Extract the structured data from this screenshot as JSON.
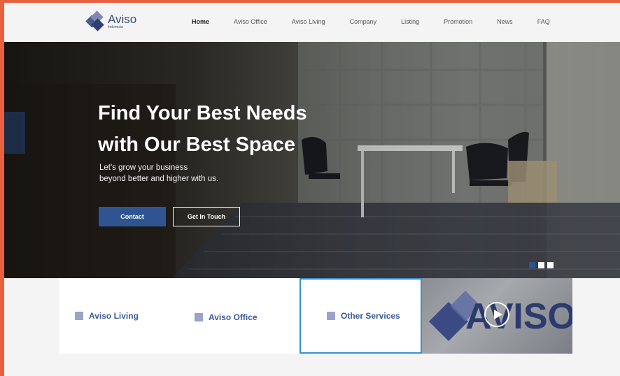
{
  "brand": {
    "name": "Aviso",
    "subtitle": "Indonesia"
  },
  "nav": {
    "items": [
      {
        "label": "Home",
        "active": true
      },
      {
        "label": "Aviso Office"
      },
      {
        "label": "Aviso Living"
      },
      {
        "label": "Company"
      },
      {
        "label": "Listing"
      },
      {
        "label": "Promotion"
      },
      {
        "label": "News"
      },
      {
        "label": "FAQ"
      }
    ]
  },
  "hero": {
    "title_line1": "Find Your Best Needs",
    "title_line2": "with Our Best Space",
    "subtitle_line1": "Let's grow your business",
    "subtitle_line2": "beyond better and higher with us.",
    "primary_button": "Contact",
    "secondary_button": "Get In Touch",
    "slides": 3,
    "active_slide": 1
  },
  "services": [
    {
      "label": "Aviso Living"
    },
    {
      "label": "Aviso Office"
    },
    {
      "label": "Other Services",
      "selected": true
    }
  ],
  "video": {
    "sign_text": "AVISO"
  },
  "colors": {
    "accent": "#2f5492",
    "frame": "#e8603d",
    "selected_border": "#3c8fd4",
    "service_text": "#3c5a9a"
  }
}
